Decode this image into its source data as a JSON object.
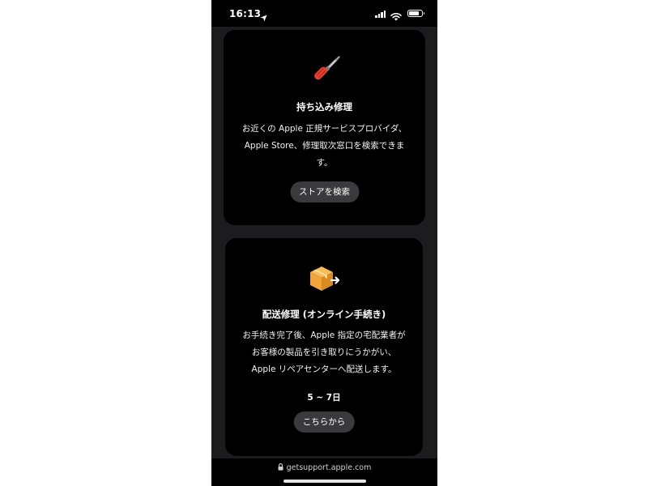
{
  "status_bar": {
    "time": "16:13"
  },
  "cards": [
    {
      "title": "持ち込み修理",
      "description_lines": [
        "お近くの Apple 正規サービスプロバイダ、",
        "Apple Store、修理取次窓口を検索できま",
        "す。"
      ],
      "button_label": "ストアを検索",
      "icon": "screwdriver-icon"
    },
    {
      "title": "配送修理 (オンライン手続き)",
      "description_lines": [
        "お手続き完了後、Apple 指定の宅配業者が",
        "お客様の製品を引き取りにうかがい、",
        "Apple リペアセンターへ配送します。"
      ],
      "duration": "5 ~ 7日",
      "button_label": "こちらから",
      "icon": "shipping-box-icon"
    }
  ],
  "browser": {
    "url": "getsupport.apple.com"
  },
  "colors": {
    "card_background": "#000000",
    "page_background": "#1c1c1e",
    "button_background": "#3a3a3c",
    "screwdriver_handle": "#e8402f",
    "box_orange": "#f2a33a"
  }
}
